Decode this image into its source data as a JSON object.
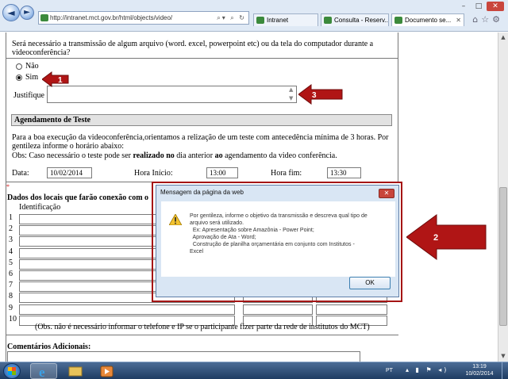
{
  "browser": {
    "address": "http://intranet.mct.gov.br/html/objects/video/",
    "tabs": [
      {
        "label": "Intranet"
      },
      {
        "label": "Consulta - Reserv..."
      },
      {
        "label": "Documento se..."
      }
    ],
    "nav": {
      "back": "◄",
      "forward": "►"
    },
    "window_controls": {
      "minimize": "–",
      "maximize": "□",
      "close": "✕"
    }
  },
  "form": {
    "question": {
      "line1": "Será necessário a transmissão de algum arquivo (word. excel, powerpoint etc) ou da tela do computador durante a",
      "line2": "videoconferência?"
    },
    "options": {
      "no": "Não",
      "yes": "Sim",
      "selected": "Sim"
    },
    "justify_label": "Justifique",
    "justify_value": "",
    "test_section": {
      "title": "Agendamento de Teste",
      "text1": "Para a boa execução da videoconferência,orientamos a relização de um teste com antecedência mínima de 3 horas. Por",
      "text2": "gentileza informe o horário abaixo:",
      "obs_pre": "Obs: Caso necessário o teste pode ser ",
      "obs_bold1": "realizado no",
      "obs_mid": " dia anterior ",
      "obs_bold2": "ao",
      "obs_post": " agendamento da video conferência.",
      "date_label": "Data:",
      "date_value": "10/02/2014",
      "start_label": "Hora Início:",
      "start_value": "13:00",
      "end_label": "Hora fim:",
      "end_value": "13:30"
    },
    "locations": {
      "required_mark": "*",
      "title": "Dados dos locais que farão conexão com o",
      "col_identification": "Identificação",
      "rows": [
        "1",
        "2",
        "3",
        "4",
        "5",
        "6",
        "7",
        "8",
        "9",
        "10"
      ],
      "note": "(Obs. não é necessário informar o telefone e IP se o participante fizer parte da rede de institutos do MCT)"
    },
    "comments_title": "Comentários Adicionais:"
  },
  "annotations": [
    "1",
    "2",
    "3"
  ],
  "dialog": {
    "title": "Mensagem da página da web",
    "icon": "warning-icon",
    "lines": [
      "Por gentileza, informe o objetivo da transmissão e descreva qual tipo de",
      "arquivo será utilizado.",
      "  Ex: Apresentação sobre Amazônia - Power Point;",
      "  Aprovação de Ata - Word;",
      "  Construção de planilha orçamentária em conjunto com Institutos -",
      "Excel"
    ],
    "ok": "OK",
    "close": "✕"
  },
  "taskbar": {
    "lang": "PT",
    "time": "13:19",
    "date": "10/02/2014"
  },
  "colors": {
    "annotation_red": "#b01515",
    "dialog_frame": "#a51515"
  }
}
